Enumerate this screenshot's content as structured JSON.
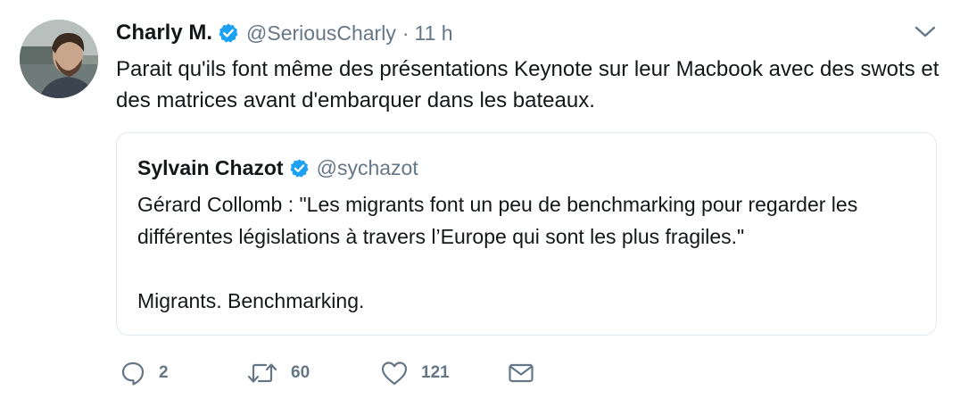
{
  "tweet": {
    "display_name": "Charly M.",
    "handle": "@SeriousCharly",
    "separator": "·",
    "time": "11 h",
    "text": "Parait qu'ils font même des présentations Keynote sur leur Macbook avec des swots et des matrices avant d'embarquer dans les bateaux."
  },
  "quoted": {
    "display_name": "Sylvain Chazot",
    "handle": "@sychazot",
    "text": "Gérard Collomb : \"Les migrants font un peu de benchmarking pour regarder les différentes législations à travers l’Europe qui sont les plus fragiles.\"\n\nMigrants. Benchmarking."
  },
  "actions": {
    "reply_count": "2",
    "retweet_count": "60",
    "like_count": "121"
  },
  "icons": {
    "verified": "verified-badge-icon",
    "caret": "chevron-down-icon",
    "reply": "reply-icon",
    "retweet": "retweet-icon",
    "like": "heart-icon",
    "dm": "envelope-icon"
  },
  "colors": {
    "verified_blue": "#1da1f2",
    "muted_text": "#657786",
    "border": "#e1e8ed"
  }
}
